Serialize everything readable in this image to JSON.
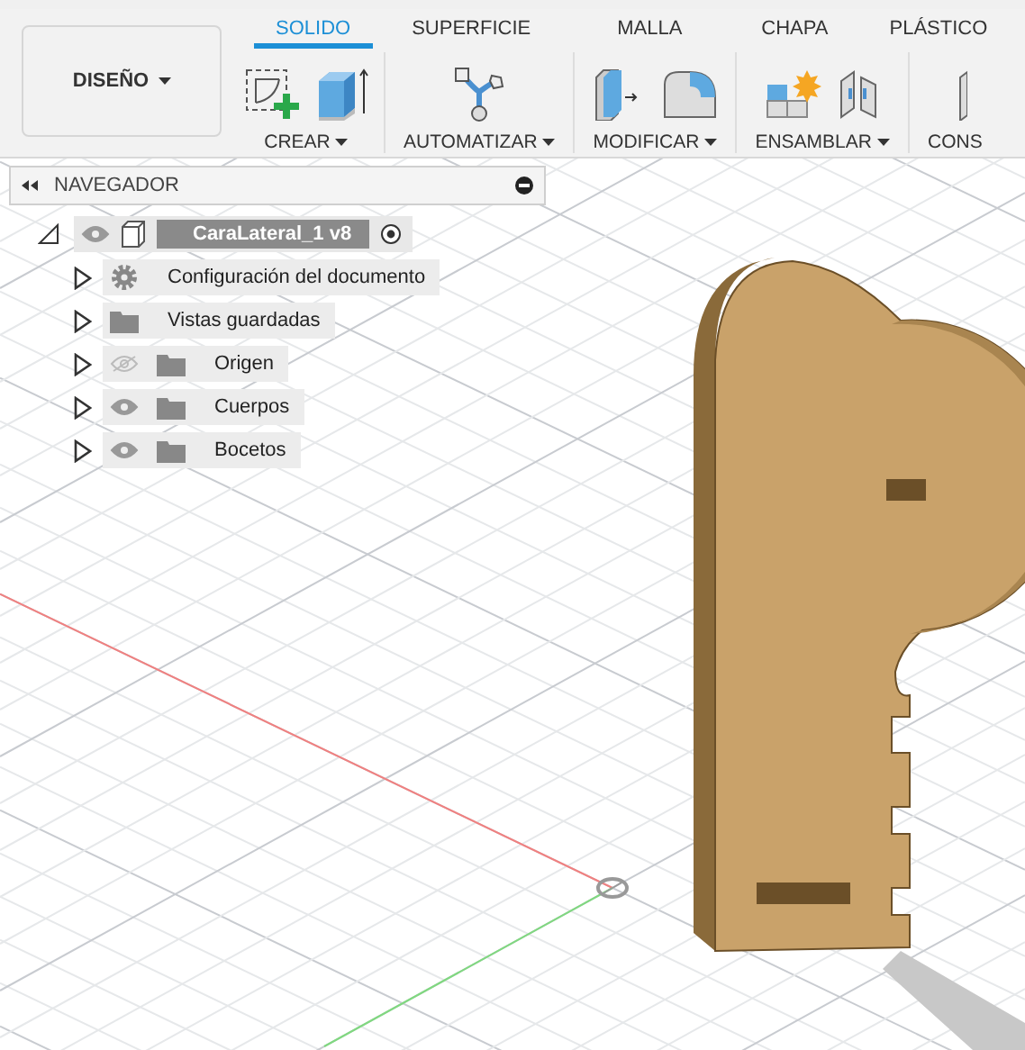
{
  "toolbar": {
    "workspace": "DISEÑO",
    "tabs": [
      {
        "label": "SOLIDO",
        "selected": true
      },
      {
        "label": "SUPERFICIE",
        "selected": false
      },
      {
        "label": "MALLA",
        "selected": false
      },
      {
        "label": "CHAPA",
        "selected": false
      },
      {
        "label": "PLÁSTICO",
        "selected": false
      }
    ],
    "groups": [
      {
        "label": "CREAR",
        "menu": true
      },
      {
        "label": "AUTOMATIZAR",
        "menu": true
      },
      {
        "label": "MODIFICAR",
        "menu": true
      },
      {
        "label": "ENSAMBLAR",
        "menu": true
      },
      {
        "label": "CONS",
        "menu": false
      }
    ]
  },
  "browser": {
    "title": "NAVEGADOR",
    "root": {
      "label": "CaraLateral_1 v8",
      "expanded": true,
      "visible": true,
      "active": true,
      "children": [
        {
          "label": "Configuración del documento",
          "kind": "settings",
          "expanded": false
        },
        {
          "label": "Vistas guardadas",
          "kind": "folder",
          "expanded": false
        },
        {
          "label": "Origen",
          "kind": "folder",
          "expanded": false,
          "visible": false
        },
        {
          "label": "Cuerpos",
          "kind": "folder",
          "expanded": false,
          "visible": true
        },
        {
          "label": "Bocetos",
          "kind": "folder",
          "expanded": false,
          "visible": true
        }
      ]
    }
  }
}
